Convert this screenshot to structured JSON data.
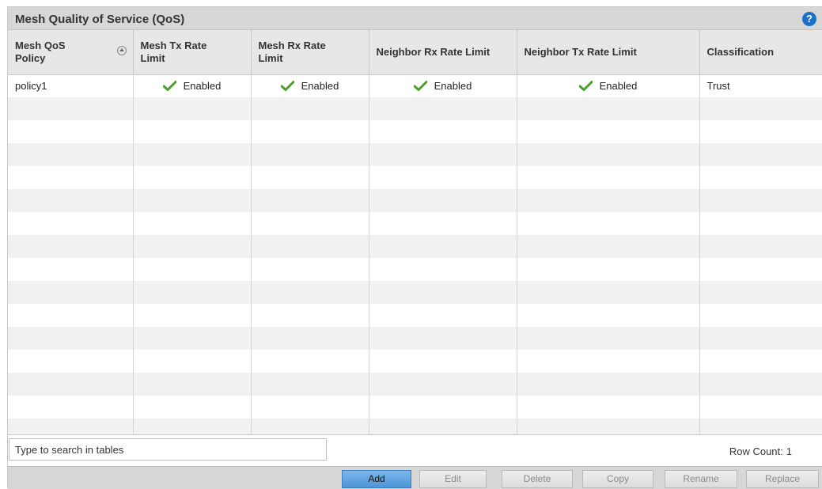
{
  "panel": {
    "title": "Mesh Quality of Service (QoS)",
    "help_glyph": "?"
  },
  "table": {
    "columns": [
      "Mesh QoS Policy",
      "Mesh Tx Rate Limit",
      "Mesh Rx Rate Limit",
      "Neighbor Rx Rate Limit",
      "Neighbor Tx Rate Limit",
      "Classification"
    ],
    "rows": [
      {
        "policy": "policy1",
        "mesh_tx": "Enabled",
        "mesh_rx": "Enabled",
        "neighbor_rx": "Enabled",
        "neighbor_tx": "Enabled",
        "classification": "Trust"
      }
    ],
    "status_icon": "checkmark-icon",
    "status_color": "#4aa02c"
  },
  "search": {
    "placeholder": "Type to search in tables"
  },
  "row_count": {
    "label": "Row Count:",
    "value": "1"
  },
  "buttons": {
    "add": "Add",
    "edit": "Edit",
    "delete": "Delete",
    "copy": "Copy",
    "rename": "Rename",
    "replace": "Replace"
  },
  "colors": {
    "accent": "#4c94d8",
    "help_icon": "#1a72c8"
  }
}
